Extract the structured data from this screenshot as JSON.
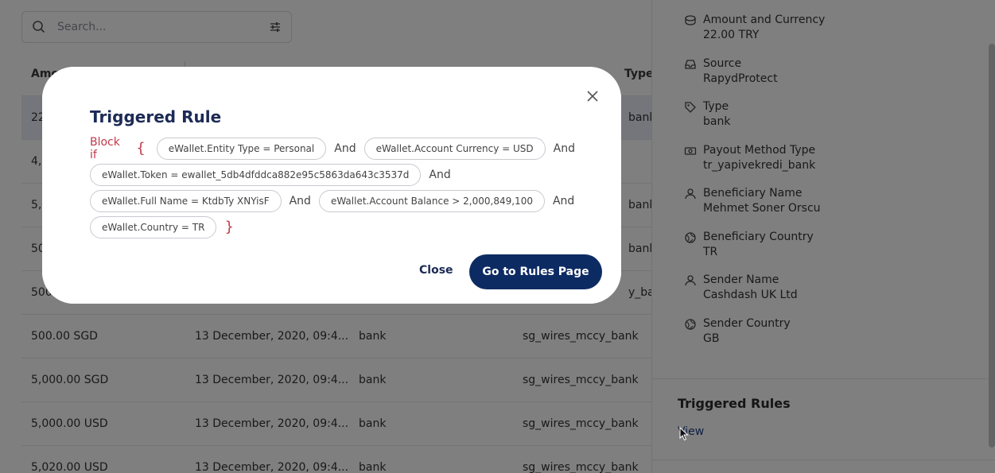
{
  "search": {
    "placeholder": "Search..."
  },
  "table": {
    "headers": [
      "Amount",
      "",
      "",
      "Type"
    ],
    "rows": [
      {
        "amount": "22.00 TRY",
        "date": "",
        "source": "",
        "type": "bank"
      },
      {
        "amount": "4,2",
        "date": "",
        "source": "",
        "type": ""
      },
      {
        "amount": "5,0",
        "date": "",
        "source": "",
        "type": "bank"
      },
      {
        "amount": "50",
        "date": "",
        "source": "",
        "type": "bank"
      },
      {
        "amount": "500",
        "date": "",
        "source": "",
        "type": "y_bank"
      },
      {
        "amount": "500.00 SGD",
        "date": "13 December, 2020, 09:4...",
        "source": "bank",
        "type": "sg_wires_mccy_bank"
      },
      {
        "amount": "5,000.00 SGD",
        "date": "13 December, 2020, 09:4...",
        "source": "bank",
        "type": "sg_wires_mccy_bank"
      },
      {
        "amount": "5,000.00 USD",
        "date": "13 December, 2020, 09:4...",
        "source": "bank",
        "type": "sg_wires_mccy_bank"
      },
      {
        "amount": "5,020.00 USD",
        "date": "13 December, 2020, 09:4...",
        "source": "bank",
        "type": "sg_wires_mccy_bank"
      }
    ]
  },
  "side": {
    "details": [
      {
        "label": "Amount and Currency",
        "value": "22.00 TRY",
        "icon": "coins-icon"
      },
      {
        "label": "Source",
        "value": "RapydProtect",
        "icon": "inbox-icon"
      },
      {
        "label": "Type",
        "value": "bank",
        "icon": "tag-icon"
      },
      {
        "label": "Payout Method Type",
        "value": "tr_yapivekredi_bank",
        "icon": "banknote-icon"
      },
      {
        "label": "Beneficiary Name",
        "value": "Mehmet Soner Orscu",
        "icon": "user-icon"
      },
      {
        "label": "Beneficiary Country",
        "value": "TR",
        "icon": "globe-icon"
      },
      {
        "label": "Sender Name",
        "value": "Cashdash UK Ltd",
        "icon": "user-icon"
      },
      {
        "label": "Sender Country",
        "value": "GB",
        "icon": "globe-icon"
      }
    ],
    "triggered_title": "Triggered Rules",
    "view_label": "View"
  },
  "modal": {
    "title": "Triggered Rule",
    "block_if": "Block if",
    "open_brace": "{",
    "close_brace": "}",
    "and_word": "And",
    "conditions": [
      "eWallet.Entity Type = Personal",
      "eWallet.Account Currency = USD",
      "eWallet.Token = ewallet_5db4dfddca882e95c5863da643c3537d",
      "eWallet.Full Name = KtdbTy XNYisF",
      "eWallet.Account Balance > 2,000,849,100",
      "eWallet.Country = TR"
    ],
    "close_label": "Close",
    "go_label": "Go to Rules Page"
  },
  "colors": {
    "primary": "#0d2b63",
    "rule_red": "#c0394a",
    "overlay": "rgba(0,0,0,0.5)"
  }
}
